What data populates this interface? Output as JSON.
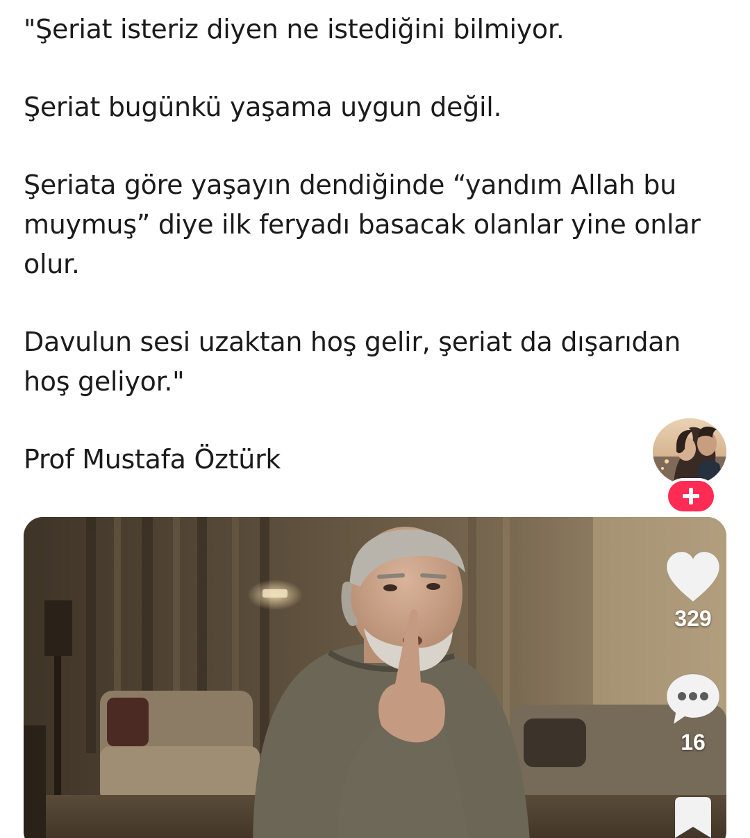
{
  "post": {
    "paragraphs": [
      "\"Şeriat isteriz diyen ne istediğini bilmiyor.",
      "Şeriat bugünkü yaşama uygun değil.",
      "Şeriata göre yaşayın dendiğinde “yandım Allah bu muymuş” diye ilk feryadı basacak olanlar yine onlar olur.",
      "Davulun sesi uzaktan hoş gelir, şeriat da dışarıdan hoş geliyor.\""
    ],
    "author": "Prof Mustafa Öztürk"
  },
  "rail": {
    "avatar_icon": "profile-avatar",
    "follow_icon": "plus-icon",
    "like_count": "329",
    "like_icon": "heart-icon",
    "comment_count": "16",
    "comment_icon": "comment-bubble-icon",
    "save_icon": "bookmark-icon",
    "follow_color": "#fe2c55"
  },
  "video": {
    "still": "man-gesturing-in-living-room"
  }
}
